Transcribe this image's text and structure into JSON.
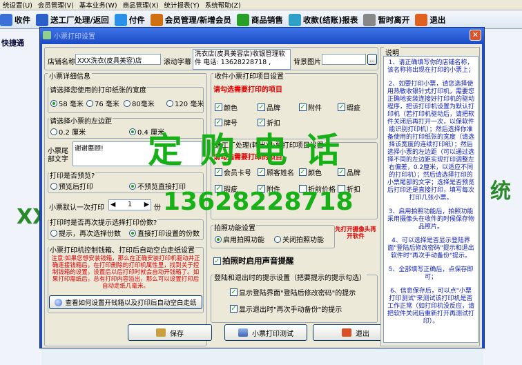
{
  "menubar": [
    "统设置(U)",
    "会员管理(V)",
    "基本业务(W)",
    "商品管理(X)",
    "统计报表(Y)",
    "系统帮助(Z)"
  ],
  "toolbar": [
    {
      "label": "收件",
      "icon": "receive-icon",
      "color": "#3a70d8"
    },
    {
      "label": "送工厂处理/返回",
      "icon": "factory-icon",
      "color": "#2a60c8"
    },
    {
      "label": "付件",
      "icon": "search-icon",
      "color": "#2a90e8"
    },
    {
      "label": "会员管理/新增会员",
      "icon": "members-icon",
      "color": "#d07010"
    },
    {
      "label": "商品销售",
      "icon": "sales-icon",
      "color": "#28a028"
    },
    {
      "label": "收款(结账)报表",
      "icon": "report-icon",
      "color": "#30a0c8"
    },
    {
      "label": "暂时离开",
      "icon": "lock-icon",
      "color": "#888888"
    },
    {
      "label": "退出",
      "icon": "exit-icon",
      "color": "#e06020"
    }
  ],
  "background": {
    "quick_link": "快捷通",
    "left_big": "XX",
    "right_big": "统"
  },
  "dialog": {
    "title": "小票打印设置",
    "store_name_label": "店铺名称",
    "store_name_value": "XXX洗衣(皮具美容)店",
    "scroll_label": "滚动字幕",
    "scroll_value": "洗衣店(皮具美容店)收银管理软件 电话: 13628228718 ,",
    "bg_image_label": "背景图片",
    "receipt_group": "小票详细信息",
    "paper_width_group": "请选择您使用的打印纸张的宽度",
    "paper_widths": [
      "58 毫米",
      "76 毫米",
      "80毫米",
      "120 毫米"
    ],
    "paper_selected": 0,
    "left_margin_group": "请选择小票的左边距",
    "margins": [
      "0.2  厘米",
      "0.4  厘米"
    ],
    "margin_selected": 1,
    "footer_label": "小票尾部文字",
    "footer_value": "谢谢惠顾!",
    "preview_group": "打印是否预览?",
    "preview_options": [
      "预览后打印",
      "不预览直接打印"
    ],
    "preview_selected": 1,
    "copies_label": "小票默认一次打印",
    "copies_value": "1",
    "copies_unit": "份",
    "prompt_group": "打印时是否再次提示选择打印份数?",
    "prompt_options": [
      "提示，再次选择份数",
      "直接打印设置的份数"
    ],
    "prompt_selected": 1,
    "drawer_group": "小票打印机控制钱箱、打印后自动空白走纸设置",
    "drawer_note": "注意:如果您想安装钱箱，那么在正确安装打印机驱动并正确连接钱箱后，在打印删除的打印机属性里，找到关于控制钱箱的设置，设置后以后打印时就会自动开钱箱了。如果打印需纸后，总有打印内容溢出，那么可以设置打印后自动走纸几毫米。",
    "drawer_button": "查看如何设置开钱箱以及打印后自动空白走纸",
    "items_group": "收件小票打印项目设置",
    "items_red": "请勾选需要打印的项目",
    "items": [
      {
        "label": "颜色",
        "checked": true
      },
      {
        "label": "品牌",
        "checked": true
      },
      {
        "label": "附件",
        "checked": true
      },
      {
        "label": "瑕疵",
        "checked": true
      },
      {
        "label": "牌号",
        "checked": true
      },
      {
        "label": "折扣",
        "checked": true
      }
    ],
    "factory_group": "送工厂处理(转出)小票打印项目设置",
    "factory_red": "请勾选需要打印的项目",
    "factory_items": [
      {
        "label": "会员卡号",
        "checked": true
      },
      {
        "label": "顾客姓名",
        "checked": true
      },
      {
        "label": "颜色",
        "checked": true
      },
      {
        "label": "品牌",
        "checked": true
      },
      {
        "label": "瑕疵",
        "checked": true
      },
      {
        "label": "附件",
        "checked": true
      },
      {
        "label": "折前价格",
        "checked": false
      },
      {
        "label": "折扣",
        "checked": false
      }
    ],
    "photo_group": "拍照功能设置",
    "photo_options": [
      "启用拍照功能",
      "关闭拍照功能"
    ],
    "photo_selected": 0,
    "photo_note": "先打开摄像头再开软件",
    "sound_label": "拍照时启用声音提醒",
    "sound_checked": true,
    "login_group": "登陆和退出时的提示设置（把要提示的提示勾选）",
    "login_options": [
      {
        "label": "显示登陆界面\"登陆后修改密码\"的提示",
        "checked": true
      },
      {
        "label": "显示退出时\"再次手动备份\"的提示",
        "checked": true
      }
    ],
    "save_button": "保存",
    "test_button": "小票打印测试",
    "exit_button": "退出",
    "help_title": "说明",
    "help_paragraphs": [
      "1、请正确填写你的店铺名称，该名称将出现在打印的小票上；",
      "2、如要打印小票，请您选择使用热敏收银针式打印机，需要您正确地安装连接好打印机的驱动程序，把该打印机设置为默认打印机（若打印机驱动后，请把软件关闭后再打开一次，以保软件能识别打印机）；然后选择你准备使用的打印纸张的宽度（请选择该宽度的连续打印纸）；然后选择小票的左边距（可以通过选择不同的左边距实现打印调整左右偏差，0.2厘米，以适应不同的打印机）；然后请选择打印的小票尾部的文字；选择是否预览后打印还是直接打印，填写每次打印几张小票。",
      "3、启用拍照功能后，拍照功能采用摄像头在收件的时候保存物品照片。",
      "4、可以选择是否显示登陆界面\"登陆后修改密码\"提示和退出软件时\"再次手动备份\"提示。",
      "5、全部填写正确后，点保存即可；",
      "6、信息保存后，可以点\"小票打印测试\"来测试该打印机是否工作正常（如打印机没反应，请把软件关闭后重新打开再测试打印）。"
    ]
  },
  "overlay": {
    "word": "定购电话",
    "phone": "13628228718"
  }
}
